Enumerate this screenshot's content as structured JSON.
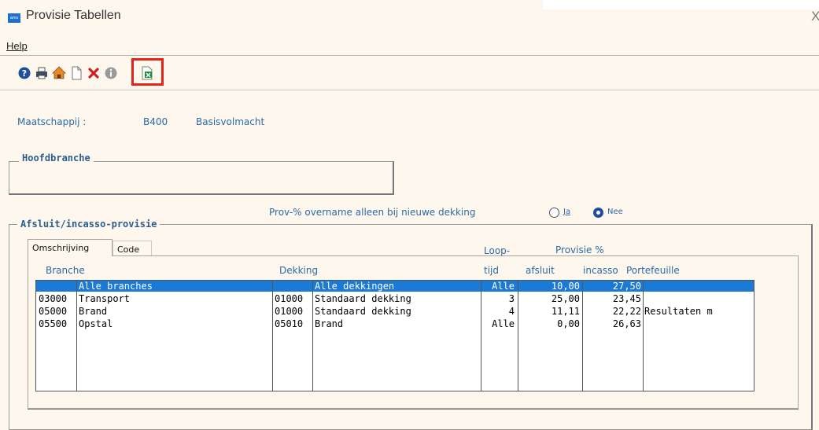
{
  "window": {
    "title": "Provisie Tabellen",
    "close_glyph": "X",
    "logo_text": "ams"
  },
  "menu": {
    "help_label": "Help"
  },
  "toolbar": {
    "icons": [
      "help-icon",
      "print-icon",
      "home-icon",
      "new-document-icon",
      "delete-icon",
      "info-icon",
      "excel-export-icon"
    ]
  },
  "company": {
    "label": "Maatschappij :",
    "code": "B400",
    "name": "Basisvolmacht"
  },
  "hoofdbranche": {
    "label": "Hoofdbranche"
  },
  "afsluit": {
    "label": "Afsluit/incasso-provisie",
    "overname_label": "Prov-% overname alleen bij nieuwe dekking",
    "option_ja": "Ja",
    "option_nee": "Nee",
    "selected": "Nee"
  },
  "tabs": [
    {
      "label": "Omschrijving",
      "active": true
    },
    {
      "label": "Code",
      "active": false
    }
  ],
  "headers": {
    "loop": "Loop-",
    "provisie": "Provisie %",
    "branche": "Branche",
    "dekking": "Dekking",
    "tijd": "tijd",
    "afsluit": "afsluit",
    "incasso": "incasso",
    "portefeuille": "Portefeuille"
  },
  "rows": [
    {
      "branche_code": "",
      "branche": "Alle branches",
      "dekking_code": "",
      "dekking": "Alle dekkingen",
      "tijd": "Alle",
      "afsluit": "10,00",
      "incasso": "27,50",
      "portefeuille": "",
      "selected": true
    },
    {
      "branche_code": "03000",
      "branche": "Transport",
      "dekking_code": "01000",
      "dekking": "Standaard dekking",
      "tijd": "3",
      "afsluit": "25,00",
      "incasso": "23,45",
      "portefeuille": "",
      "selected": false
    },
    {
      "branche_code": "05000",
      "branche": "Brand",
      "dekking_code": "01000",
      "dekking": "Standaard dekking",
      "tijd": "4",
      "afsluit": "11,11",
      "incasso": "22,22",
      "portefeuille": "Resultaten m",
      "selected": false
    },
    {
      "branche_code": "05500",
      "branche": "Opstal",
      "dekking_code": "05010",
      "dekking": "Brand",
      "tijd": "Alle",
      "afsluit": "0,00",
      "incasso": "26,63",
      "portefeuille": "",
      "selected": false
    }
  ],
  "colors": {
    "accent": "#2c6ba6",
    "selection": "#1a7ad6",
    "highlight": "#e2231a",
    "background": "#fdf7ee"
  }
}
